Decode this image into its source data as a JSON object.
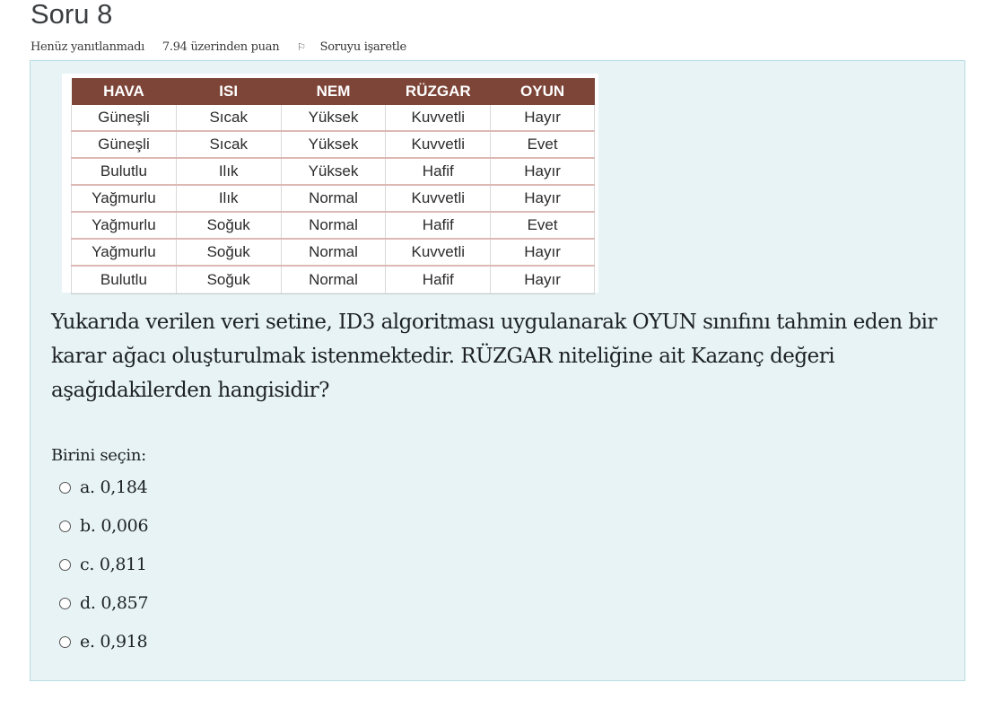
{
  "question": {
    "title": "Soru 8",
    "status": "Henüz yanıtlanmadı",
    "points": "7.94 üzerinden puan",
    "flag_label": "Soruyu işaretle",
    "flag_icon": "flag-icon",
    "text": "Yukarıda verilen veri setine, ID3 algoritması uygulanarak OYUN sınıfını tahmin eden bir karar ağacı oluşturulmak istenmektedir. RÜZGAR niteliğine ait Kazanç değeri aşağıdakilerden hangisidir?",
    "prompt": "Birini seçin:"
  },
  "table": {
    "headers": [
      "HAVA",
      "ISI",
      "NEM",
      "RÜZGAR",
      "OYUN"
    ],
    "rows": [
      [
        "Güneşli",
        "Sıcak",
        "Yüksek",
        "Kuvvetli",
        "Hayır"
      ],
      [
        "Güneşli",
        "Sıcak",
        "Yüksek",
        "Kuvvetli",
        "Evet"
      ],
      [
        "Bulutlu",
        "Ilık",
        "Yüksek",
        "Hafif",
        "Hayır"
      ],
      [
        "Yağmurlu",
        "Ilık",
        "Normal",
        "Kuvvetli",
        "Hayır"
      ],
      [
        "Yağmurlu",
        "Soğuk",
        "Normal",
        "Hafif",
        "Evet"
      ],
      [
        "Yağmurlu",
        "Soğuk",
        "Normal",
        "Kuvvetli",
        "Hayır"
      ],
      [
        "Bulutlu",
        "Soğuk",
        "Normal",
        "Hafif",
        "Hayır"
      ]
    ]
  },
  "answers": [
    {
      "label": "a. 0,184"
    },
    {
      "label": "b. 0,006"
    },
    {
      "label": "c. 0,811"
    },
    {
      "label": "d. 0,857"
    },
    {
      "label": "e. 0,918"
    }
  ],
  "colors": {
    "header_bg": "#7d4538",
    "content_bg": "#e7f3f5",
    "content_border": "#b8dce2"
  }
}
